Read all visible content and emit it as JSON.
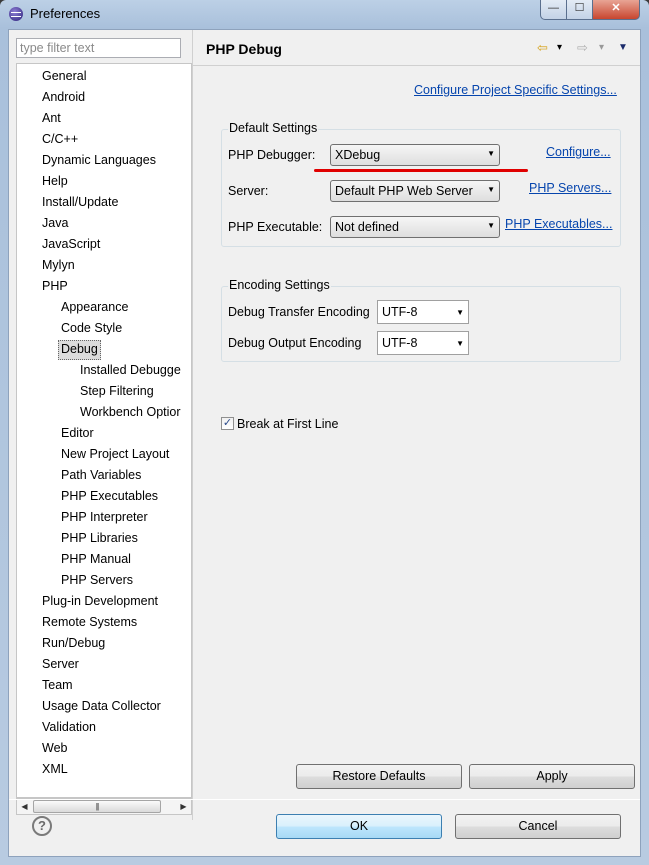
{
  "window": {
    "title": "Preferences",
    "min_glyph": "—",
    "max_glyph": "☐",
    "close_glyph": "✕"
  },
  "filter": {
    "placeholder": "type filter text"
  },
  "tree": [
    {
      "label": "General",
      "level": 0
    },
    {
      "label": "Android",
      "level": 0
    },
    {
      "label": "Ant",
      "level": 0
    },
    {
      "label": "C/C++",
      "level": 0
    },
    {
      "label": "Dynamic Languages",
      "level": 0
    },
    {
      "label": "Help",
      "level": 0
    },
    {
      "label": "Install/Update",
      "level": 0
    },
    {
      "label": "Java",
      "level": 0
    },
    {
      "label": "JavaScript",
      "level": 0
    },
    {
      "label": "Mylyn",
      "level": 0
    },
    {
      "label": "PHP",
      "level": 0
    },
    {
      "label": "Appearance",
      "level": 1
    },
    {
      "label": "Code Style",
      "level": 1
    },
    {
      "label": "Debug",
      "level": 1,
      "selected": true
    },
    {
      "label": "Installed Debugge",
      "level": 2
    },
    {
      "label": "Step Filtering",
      "level": 2
    },
    {
      "label": "Workbench Optior",
      "level": 2
    },
    {
      "label": "Editor",
      "level": 1
    },
    {
      "label": "New Project Layout",
      "level": 1
    },
    {
      "label": "Path Variables",
      "level": 1
    },
    {
      "label": "PHP Executables",
      "level": 1
    },
    {
      "label": "PHP Interpreter",
      "level": 1
    },
    {
      "label": "PHP Libraries",
      "level": 1
    },
    {
      "label": "PHP Manual",
      "level": 1
    },
    {
      "label": "PHP Servers",
      "level": 1
    },
    {
      "label": "Plug-in Development",
      "level": 0
    },
    {
      "label": "Remote Systems",
      "level": 0
    },
    {
      "label": "Run/Debug",
      "level": 0
    },
    {
      "label": "Server",
      "level": 0
    },
    {
      "label": "Team",
      "level": 0
    },
    {
      "label": "Usage Data Collector",
      "level": 0
    },
    {
      "label": "Validation",
      "level": 0
    },
    {
      "label": "Web",
      "level": 0
    },
    {
      "label": "XML",
      "level": 0
    }
  ],
  "page": {
    "title": "PHP Debug",
    "nav": {
      "back": "⇦",
      "forward": "⇨",
      "drop": "▾",
      "menu": "▼"
    },
    "configure_project": "Configure Project Specific Settings...",
    "default_settings": {
      "label": "Default Settings",
      "debugger_label": "PHP Debugger:",
      "debugger_value": "XDebug",
      "configure_link": "Configure...",
      "server_label": "Server:",
      "server_value": "Default PHP Web Server",
      "servers_link": "PHP Servers...",
      "exe_label": "PHP Executable:",
      "exe_value": "Not defined",
      "exes_link": "PHP Executables..."
    },
    "encoding": {
      "label": "Encoding Settings",
      "transfer_label": "Debug Transfer Encoding",
      "transfer_value": "UTF-8",
      "output_label": "Debug Output Encoding",
      "output_value": "UTF-8"
    },
    "break_first_line": {
      "label": "Break at First Line",
      "checked": true
    },
    "restore_defaults": "Restore Defaults",
    "apply": "Apply"
  },
  "footer": {
    "help": "?",
    "ok": "OK",
    "cancel": "Cancel"
  },
  "colors": {
    "link": "#0645ad",
    "highlight_line": "#e00000"
  }
}
